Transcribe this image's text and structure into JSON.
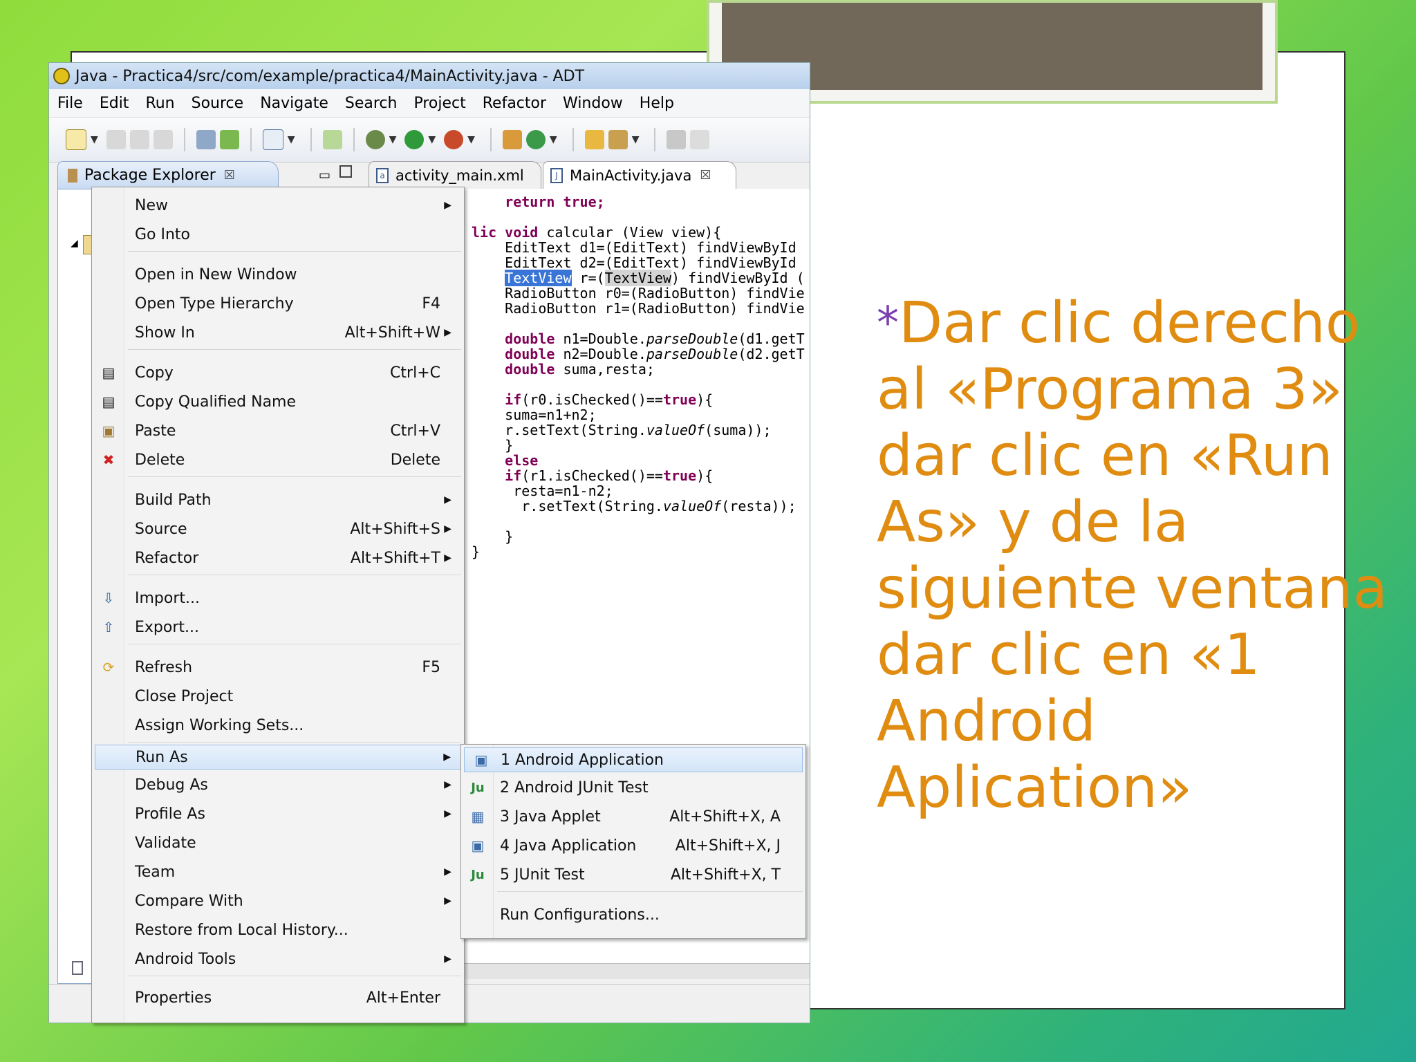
{
  "window": {
    "title": "Java - Practica4/src/com/example/practica4/MainActivity.java - ADT",
    "menubar": [
      "File",
      "Edit",
      "Run",
      "Source",
      "Navigate",
      "Search",
      "Project",
      "Refactor",
      "Window",
      "Help"
    ]
  },
  "tabs": {
    "package_explorer": "Package Explorer",
    "editor_tabs": [
      "activity_main.xml",
      "MainActivity.java"
    ]
  },
  "code": {
    "l1": "return true;",
    "l2a": "lic ",
    "l2b": "void",
    "l2c": " calcular (View view){",
    "l3": "EditText d1=(EditText) findViewById",
    "l4": "EditText d2=(EditText) findViewById",
    "l5a": "TextView",
    "l5b": " r=(",
    "l5c": "TextView",
    "l5d": ") findViewById (",
    "l6": "RadioButton r0=(RadioButton) findVie",
    "l7": "RadioButton r1=(RadioButton) findVie",
    "l8a": "double",
    "l8b": " n1=Double.",
    "l8c": "parseDouble",
    "l8d": "(d1.getT",
    "l9a": "double",
    "l9b": " n2=Double.",
    "l9c": "parseDouble",
    "l9d": "(d2.getT",
    "l10a": "double",
    "l10b": " suma,resta;",
    "l11a": "if",
    "l11b": "(r0.isChecked()==",
    "l11c": "true",
    "l11d": "){",
    "l12": "suma=n1+n2;",
    "l13a": "r.setText(String.",
    "l13b": "valueOf",
    "l13c": "(suma));",
    "l14": "}",
    "l15": "else",
    "l16a": "if",
    "l16b": "(r1.isChecked()==",
    "l16c": "true",
    "l16d": "){",
    "l17": " resta=n1-n2;",
    "l18a": "  r.setText(String.",
    "l18b": "valueOf",
    "l18c": "(resta));",
    "l19": "}",
    "l20": "}"
  },
  "context_menu": {
    "new": "New",
    "go_into": "Go Into",
    "open_new_window": "Open in New Window",
    "open_type_hierarchy": "Open Type Hierarchy",
    "open_type_hierarchy_sc": "F4",
    "show_in": "Show In",
    "show_in_sc": "Alt+Shift+W",
    "copy": "Copy",
    "copy_sc": "Ctrl+C",
    "copy_qualified": "Copy Qualified Name",
    "paste": "Paste",
    "paste_sc": "Ctrl+V",
    "delete": "Delete",
    "delete_sc": "Delete",
    "build_path": "Build Path",
    "source": "Source",
    "source_sc": "Alt+Shift+S",
    "refactor": "Refactor",
    "refactor_sc": "Alt+Shift+T",
    "import": "Import...",
    "export": "Export...",
    "refresh": "Refresh",
    "refresh_sc": "F5",
    "close_project": "Close Project",
    "assign_working_sets": "Assign Working Sets...",
    "run_as": "Run As",
    "debug_as": "Debug As",
    "profile_as": "Profile As",
    "validate": "Validate",
    "team": "Team",
    "compare_with": "Compare With",
    "restore_history": "Restore from Local History...",
    "android_tools": "Android Tools",
    "properties": "Properties",
    "properties_sc": "Alt+Enter"
  },
  "run_as_submenu": {
    "android_app": "1 Android Application",
    "android_junit": "2 Android JUnit Test",
    "java_applet": "3 Java Applet",
    "java_applet_sc": "Alt+Shift+X, A",
    "java_app": "4 Java Application",
    "java_app_sc": "Alt+Shift+X, J",
    "junit": "5 JUnit Test",
    "junit_sc": "Alt+Shift+X, T",
    "run_configs": "Run Configurations..."
  },
  "caption": {
    "bullet": "*",
    "text": "Dar clic derecho al «Programa 3» dar clic en «Run As» y de la siguiente ventana dar clic en «1 Android Aplication»"
  },
  "colors": {
    "caption": "#e08c10",
    "bullet": "#7a40b0",
    "keyword": "#7f0055",
    "selection": "#3875d7"
  }
}
